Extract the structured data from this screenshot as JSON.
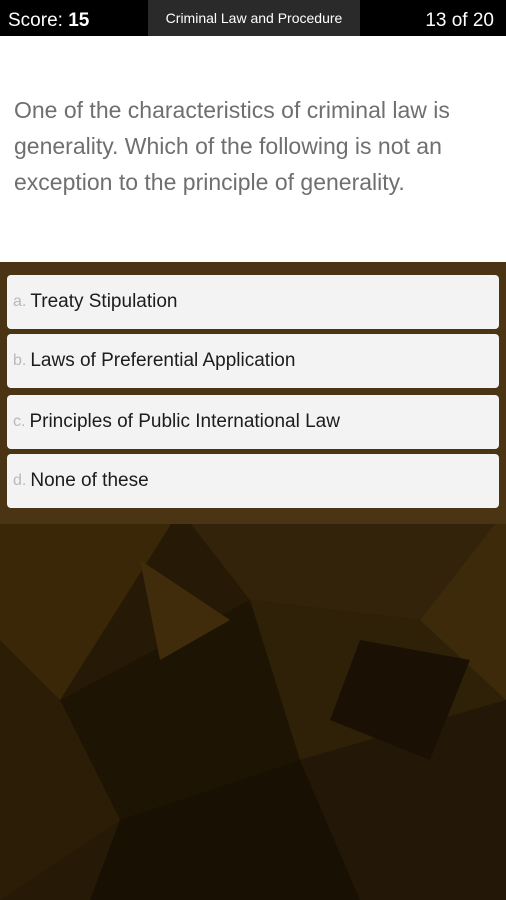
{
  "header": {
    "score_label": "Score:",
    "score_value": "15",
    "quiz_title": "Criminal Law and Procedure",
    "progress": "13 of 20"
  },
  "question": {
    "text": "One of the characteristics of criminal law is generality. Which of the following is not an exception to the principle of generality."
  },
  "options": [
    {
      "letter": "a.",
      "text": "Treaty Stipulation"
    },
    {
      "letter": "b.",
      "text": "Laws of Preferential Application"
    },
    {
      "letter": "c.",
      "text": "Principles of Public International Law"
    },
    {
      "letter": "d.",
      "text": "None of these"
    }
  ],
  "colors": {
    "header_bg": "#000000",
    "title_tab_bg": "#2a2a2a",
    "question_bg": "#ffffff",
    "question_text": "#6f6f6f",
    "option_bg": "#f3f3f3",
    "background_brown": "#2a1c08"
  }
}
